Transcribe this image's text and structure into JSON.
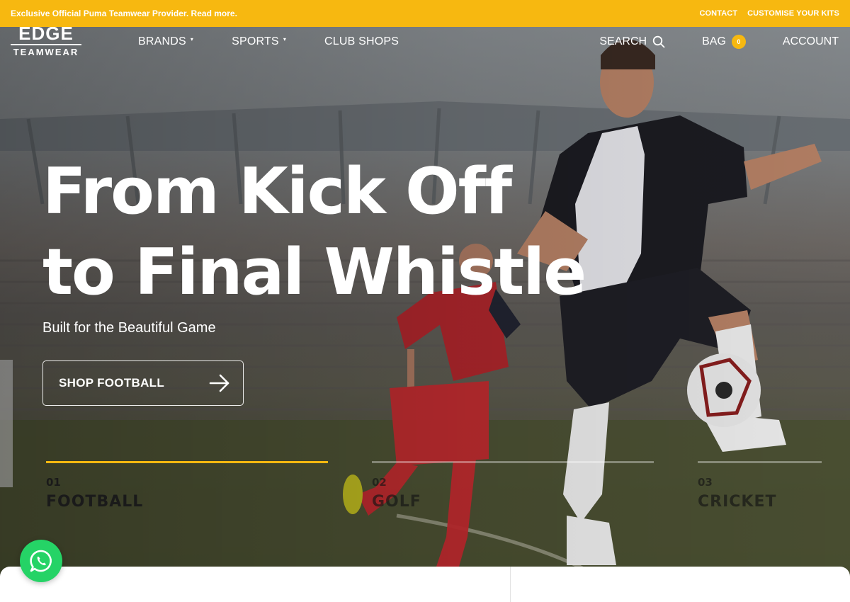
{
  "announcement": {
    "text": "Exclusive Official Puma  Teamwear Provider. Read more.",
    "links": [
      "CONTACT",
      "CUSTOMISE YOUR KITS"
    ]
  },
  "logo": {
    "line1": "EDGE",
    "line2": "TEAMWEAR"
  },
  "nav": {
    "items": [
      {
        "label": "BRANDS",
        "dropdown": true
      },
      {
        "label": "SPORTS",
        "dropdown": true
      },
      {
        "label": "CLUB SHOPS",
        "dropdown": false
      }
    ]
  },
  "utils": {
    "search_label": "SEARCH",
    "bag_label": "BAG",
    "bag_count": "0",
    "account_label": "ACCOUNT"
  },
  "hero": {
    "headline_line1": "From Kick Off",
    "headline_line2": "to Final Whistle",
    "subheadline": "Built for the Beautiful Game",
    "cta_label": "SHOP FOOTBALL"
  },
  "slides": [
    {
      "num": "01",
      "label": "FOOTBALL",
      "active": true
    },
    {
      "num": "02",
      "label": "GOLF",
      "active": false
    },
    {
      "num": "03",
      "label": "CRICKET",
      "active": false
    }
  ],
  "colors": {
    "accent": "#f7b810",
    "whatsapp": "#25d366"
  }
}
